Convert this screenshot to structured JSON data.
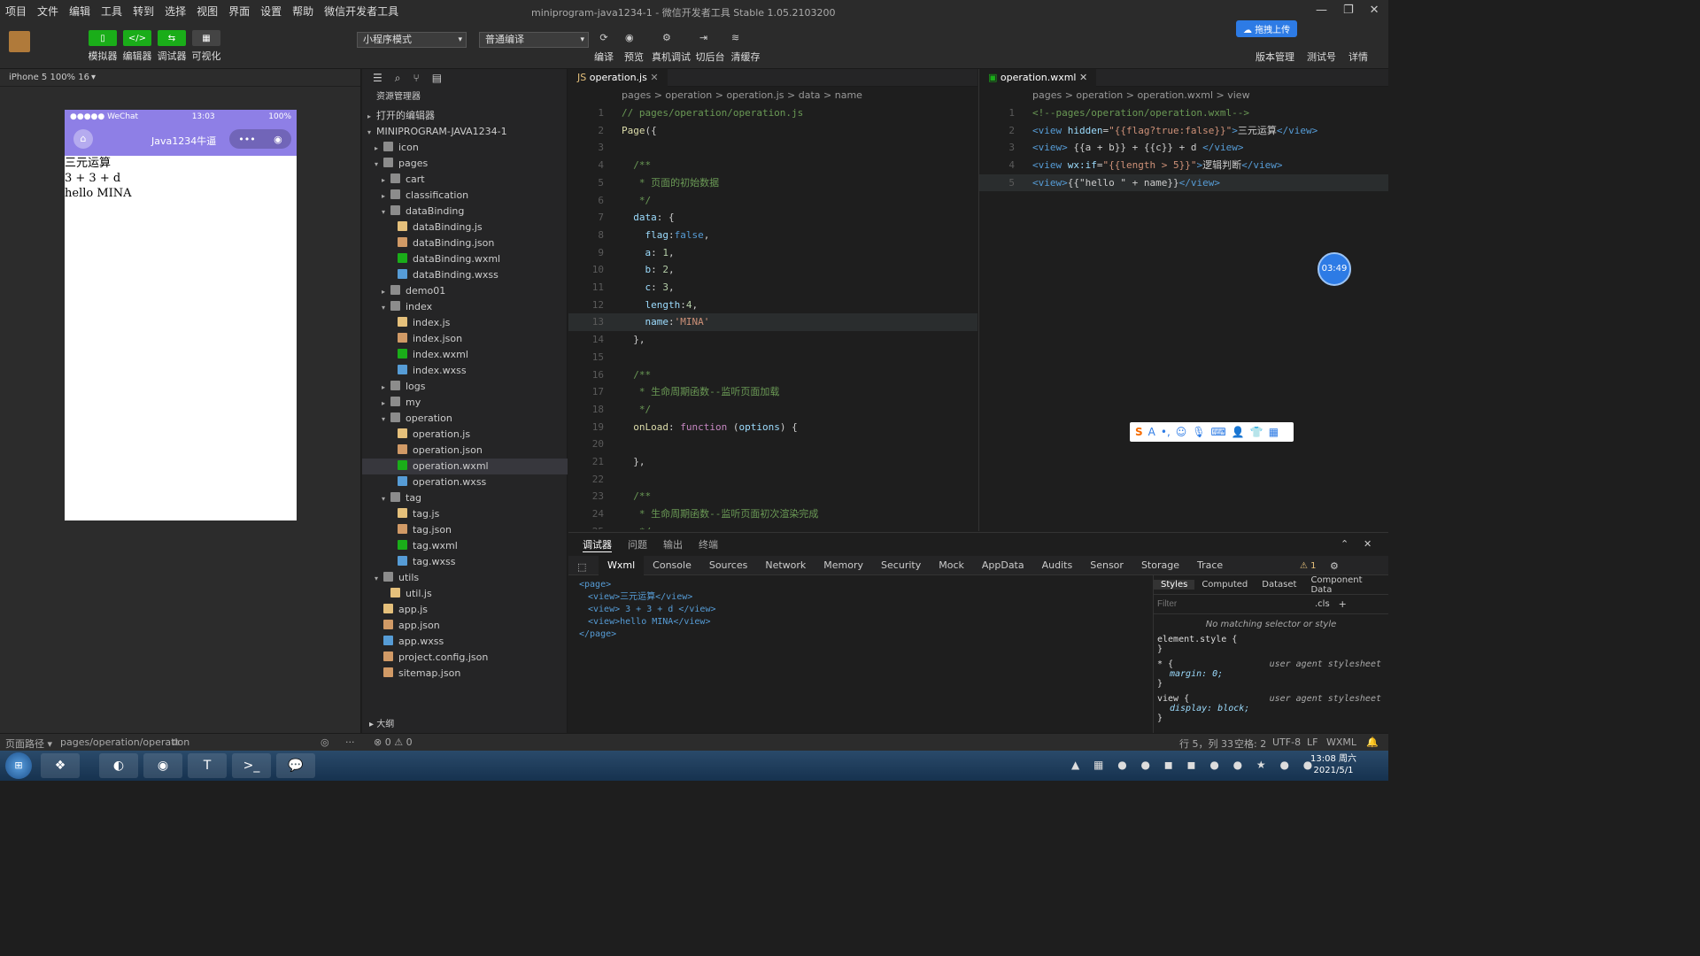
{
  "menu": [
    "项目",
    "文件",
    "编辑",
    "工具",
    "转到",
    "选择",
    "视图",
    "界面",
    "设置",
    "帮助",
    "微信开发者工具"
  ],
  "window_title": "miniprogram-java1234-1 - 微信开发者工具 Stable 1.05.2103200",
  "toolbar": {
    "buttons": [
      "模拟器",
      "编辑器",
      "调试器",
      "可视化"
    ],
    "mode_select": "小程序模式",
    "compile_select": "普通编译",
    "actions": [
      "编译",
      "预览",
      "真机调试",
      "切后台",
      "清缓存"
    ],
    "right_actions": [
      "版本管理",
      "测试号",
      "详情"
    ],
    "upload_tip": "拖拽上传"
  },
  "simulator": {
    "device": "iPhone 5 100% 16",
    "status_left": "●●●●● WeChat",
    "status_time": "13:03",
    "status_battery": "100%",
    "nav_title": "Java1234牛逼",
    "content": [
      "三元运算",
      "3 + 3 + d",
      "hello MINA"
    ]
  },
  "explorer": {
    "title": "资源管理器",
    "open_editors": "打开的编辑器",
    "project": "MINIPROGRAM-JAVA1234-1",
    "items": [
      {
        "label": "icon",
        "type": "folder",
        "depth": 1,
        "open": false
      },
      {
        "label": "pages",
        "type": "folder",
        "depth": 1,
        "open": true
      },
      {
        "label": "cart",
        "type": "folder",
        "depth": 2,
        "open": false
      },
      {
        "label": "classification",
        "type": "folder",
        "depth": 2,
        "open": false
      },
      {
        "label": "dataBinding",
        "type": "folder",
        "depth": 2,
        "open": true
      },
      {
        "label": "dataBinding.js",
        "type": "js",
        "depth": 3
      },
      {
        "label": "dataBinding.json",
        "type": "json",
        "depth": 3
      },
      {
        "label": "dataBinding.wxml",
        "type": "wxml",
        "depth": 3
      },
      {
        "label": "dataBinding.wxss",
        "type": "wxss",
        "depth": 3
      },
      {
        "label": "demo01",
        "type": "folder",
        "depth": 2,
        "open": false
      },
      {
        "label": "index",
        "type": "folder",
        "depth": 2,
        "open": true
      },
      {
        "label": "index.js",
        "type": "js",
        "depth": 3
      },
      {
        "label": "index.json",
        "type": "json",
        "depth": 3
      },
      {
        "label": "index.wxml",
        "type": "wxml",
        "depth": 3
      },
      {
        "label": "index.wxss",
        "type": "wxss",
        "depth": 3
      },
      {
        "label": "logs",
        "type": "folder",
        "depth": 2,
        "open": false
      },
      {
        "label": "my",
        "type": "folder",
        "depth": 2,
        "open": false
      },
      {
        "label": "operation",
        "type": "folder",
        "depth": 2,
        "open": true
      },
      {
        "label": "operation.js",
        "type": "js",
        "depth": 3
      },
      {
        "label": "operation.json",
        "type": "json",
        "depth": 3
      },
      {
        "label": "operation.wxml",
        "type": "wxml",
        "depth": 3,
        "selected": true
      },
      {
        "label": "operation.wxss",
        "type": "wxss",
        "depth": 3
      },
      {
        "label": "tag",
        "type": "folder",
        "depth": 2,
        "open": true
      },
      {
        "label": "tag.js",
        "type": "js",
        "depth": 3
      },
      {
        "label": "tag.json",
        "type": "json",
        "depth": 3
      },
      {
        "label": "tag.wxml",
        "type": "wxml",
        "depth": 3
      },
      {
        "label": "tag.wxss",
        "type": "wxss",
        "depth": 3
      },
      {
        "label": "utils",
        "type": "folder",
        "depth": 1,
        "open": true
      },
      {
        "label": "util.js",
        "type": "js",
        "depth": 2
      },
      {
        "label": "app.js",
        "type": "js",
        "depth": 1
      },
      {
        "label": "app.json",
        "type": "json",
        "depth": 1
      },
      {
        "label": "app.wxss",
        "type": "wxss",
        "depth": 1
      },
      {
        "label": "project.config.json",
        "type": "json",
        "depth": 1
      },
      {
        "label": "sitemap.json",
        "type": "json",
        "depth": 1
      }
    ],
    "outline": "大纲"
  },
  "editor_js": {
    "tab": "operation.js",
    "breadcrumb": "pages > operation > operation.js > data > name",
    "lines": [
      [
        [
          "cm",
          "// pages/operation/operation.js"
        ]
      ],
      [
        [
          "fn",
          "Page"
        ],
        [
          "",
          "({"
        ]
      ],
      [
        [
          "",
          ""
        ]
      ],
      [
        [
          "cm",
          "  /**"
        ]
      ],
      [
        [
          "cm",
          "   * 页面的初始数据"
        ]
      ],
      [
        [
          "cm",
          "   */"
        ]
      ],
      [
        [
          "pr",
          "  data"
        ],
        [
          "",
          ": {"
        ]
      ],
      [
        [
          "pr",
          "    flag"
        ],
        [
          "",
          ":"
        ],
        [
          "tg",
          "false"
        ],
        [
          "",
          ","
        ]
      ],
      [
        [
          "pr",
          "    a"
        ],
        [
          "",
          ": "
        ],
        [
          "nm",
          "1"
        ],
        [
          "",
          ","
        ]
      ],
      [
        [
          "pr",
          "    b"
        ],
        [
          "",
          ": "
        ],
        [
          "nm",
          "2"
        ],
        [
          "",
          ","
        ]
      ],
      [
        [
          "pr",
          "    c"
        ],
        [
          "",
          ": "
        ],
        [
          "nm",
          "3"
        ],
        [
          "",
          ","
        ]
      ],
      [
        [
          "pr",
          "    length"
        ],
        [
          "",
          ":"
        ],
        [
          "nm",
          "4"
        ],
        [
          "",
          ","
        ]
      ],
      [
        [
          "pr",
          "    name"
        ],
        [
          "",
          ":"
        ],
        [
          "str",
          "'MINA'"
        ]
      ],
      [
        [
          "",
          "  },"
        ]
      ],
      [
        [
          "",
          ""
        ]
      ],
      [
        [
          "cm",
          "  /**"
        ]
      ],
      [
        [
          "cm",
          "   * 生命周期函数--监听页面加载"
        ]
      ],
      [
        [
          "cm",
          "   */"
        ]
      ],
      [
        [
          "fn",
          "  onLoad"
        ],
        [
          "",
          ": "
        ],
        [
          "kw",
          "function"
        ],
        [
          "",
          " ("
        ],
        [
          "pr",
          "options"
        ],
        [
          "",
          ") {"
        ]
      ],
      [
        [
          "",
          ""
        ]
      ],
      [
        [
          "",
          "  },"
        ]
      ],
      [
        [
          "",
          ""
        ]
      ],
      [
        [
          "cm",
          "  /**"
        ]
      ],
      [
        [
          "cm",
          "   * 生命周期函数--监听页面初次渲染完成"
        ]
      ],
      [
        [
          "cm",
          "   */"
        ]
      ]
    ]
  },
  "editor_wxml": {
    "tab": "operation.wxml",
    "breadcrumb": "pages > operation > operation.wxml > view",
    "lines": [
      [
        [
          "cm",
          "<!--pages/operation/operation.wxml-->"
        ]
      ],
      [
        [
          "tg",
          "<view "
        ],
        [
          "at",
          "hidden"
        ],
        [
          "",
          "="
        ],
        [
          "str",
          "\"{{flag?true:false}}\""
        ],
        [
          "tg",
          ">"
        ],
        [
          "",
          "三元运算"
        ],
        [
          "tg",
          "</view>"
        ]
      ],
      [
        [
          "tg",
          "<view>"
        ],
        [
          "",
          " {{a + b}} + {{c}} + d "
        ],
        [
          "tg",
          "</view>"
        ]
      ],
      [
        [
          "tg",
          "<view "
        ],
        [
          "at",
          "wx:if"
        ],
        [
          "",
          "="
        ],
        [
          "str",
          "\"{{length > 5}}\""
        ],
        [
          "tg",
          ">"
        ],
        [
          "",
          "逻辑判断"
        ],
        [
          "tg",
          "</view>"
        ]
      ],
      [
        [
          "tg",
          "<view>"
        ],
        [
          "",
          "{{\"hello \" + name}}"
        ],
        [
          "tg",
          "</view>"
        ]
      ]
    ]
  },
  "timer": "03:49",
  "debug": {
    "tabs": [
      "调试器",
      "问题",
      "输出",
      "终端"
    ],
    "panels": [
      "Wxml",
      "Console",
      "Sources",
      "Network",
      "Memory",
      "Security",
      "Mock",
      "AppData",
      "Audits",
      "Sensor",
      "Storage",
      "Trace"
    ],
    "warnings": "1",
    "wxml_tree": [
      "<page>",
      "<view>三元运算</view>",
      "<view> 3 + 3 + d </view>",
      "<view>hello MINA</view>",
      "</page>"
    ],
    "style_tabs": [
      "Styles",
      "Computed",
      "Dataset",
      "Component Data"
    ],
    "filter_placeholder": "Filter",
    "cls": ".cls",
    "no_match": "No matching selector or style",
    "rules": [
      {
        "selector": "element.style {",
        "prop": "",
        "end": "}",
        "src": ""
      },
      {
        "selector": "* {",
        "prop": "margin: 0;",
        "end": "}",
        "src": "user agent stylesheet"
      },
      {
        "selector": "view {",
        "prop": "display: block;",
        "end": "}",
        "src": "user agent stylesheet"
      }
    ]
  },
  "status": {
    "page_path_label": "页面路径",
    "page_path": "pages/operation/operation",
    "errors": "⊗ 0 ⚠ 0",
    "cursor": "行 5，列 33",
    "spaces": "空格: 2",
    "encoding": "UTF-8",
    "eol": "LF",
    "lang": "WXML"
  },
  "taskbar": {
    "time": "13:08 周六",
    "date": "2021/5/1"
  }
}
